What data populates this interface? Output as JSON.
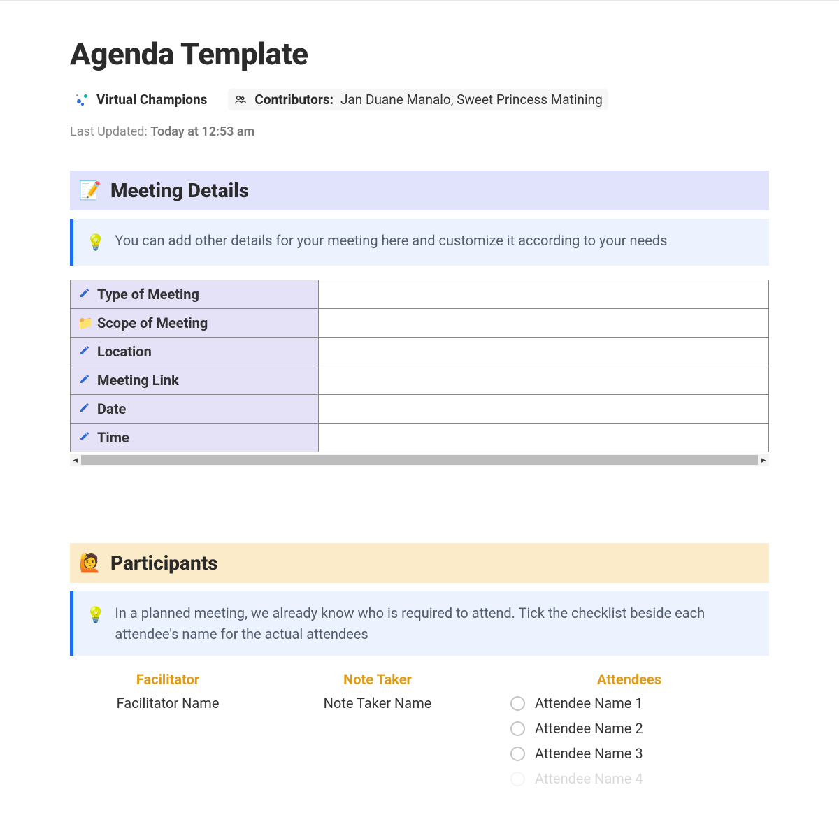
{
  "header": {
    "title": "Agenda Template",
    "org_name": "Virtual Champions",
    "contributors_label": "Contributors",
    "contributors_value": "Jan Duane Manalo, Sweet Princess Matining",
    "last_updated_label": "Last Updated:",
    "last_updated_value": "Today at 12:53 am"
  },
  "meeting_details": {
    "heading": "Meeting Details",
    "callout": "You can add other details for your meeting here and customize it according to your needs",
    "rows": [
      {
        "icon": "pencil",
        "label": "Type of Meeting",
        "value": ""
      },
      {
        "icon": "folder",
        "label": "Scope of Meeting",
        "value": ""
      },
      {
        "icon": "pencil",
        "label": "Location",
        "value": ""
      },
      {
        "icon": "pencil",
        "label": "Meeting Link",
        "value": ""
      },
      {
        "icon": "pencil",
        "label": "Date",
        "value": ""
      },
      {
        "icon": "pencil",
        "label": "Time",
        "value": ""
      }
    ]
  },
  "participants": {
    "heading": "Participants",
    "callout": "In a planned meeting, we already know who is required to attend. Tick the checklist beside each attendee's name for the actual attendees",
    "facilitator_header": "Facilitator",
    "facilitator_value": "Facilitator Name",
    "note_taker_header": "Note Taker",
    "note_taker_value": "Note Taker Name",
    "attendees_header": "Attendees",
    "attendees": [
      "Attendee Name 1",
      "Attendee Name 2",
      "Attendee Name 3",
      "Attendee Name 4"
    ]
  }
}
